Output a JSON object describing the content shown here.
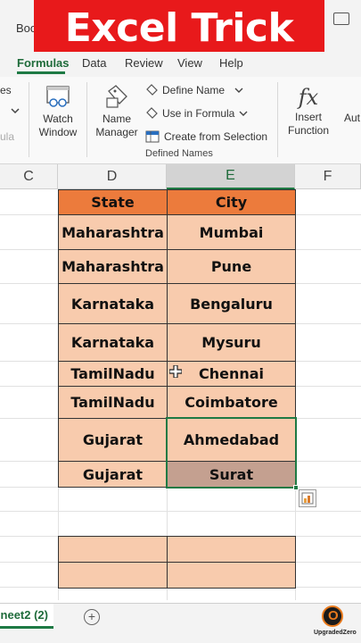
{
  "window": {
    "doc_title": "Boo"
  },
  "banner": {
    "text": "Excel Trick"
  },
  "tabs": [
    "Formulas",
    "Data",
    "Review",
    "View",
    "Help"
  ],
  "ribbon": {
    "left_partial_1": "es",
    "left_partial_2": "ula",
    "watch_window": [
      "Watch",
      "Window"
    ],
    "name_manager": [
      "Name",
      "Manager"
    ],
    "define_name": "Define Name",
    "use_in_formula": "Use in Formula",
    "create_from_selection": "Create from Selection",
    "group_label": "Defined Names",
    "insert_function_icon": "fx",
    "insert_function": [
      "Insert",
      "Function"
    ],
    "auto_partial": "Aut"
  },
  "columns": [
    "C",
    "D",
    "E",
    "F"
  ],
  "table": {
    "headers": {
      "state": "State",
      "city": "City"
    },
    "rows": [
      {
        "state": "Maharashtra",
        "city": "Mumbai"
      },
      {
        "state": "Maharashtra",
        "city": "Pune"
      },
      {
        "state": "Karnataka",
        "city": "Bengaluru"
      },
      {
        "state": "Karnataka",
        "city": "Mysuru"
      },
      {
        "state": "TamilNadu",
        "city": "Chennai"
      },
      {
        "state": "TamilNadu",
        "city": "Coimbatore"
      },
      {
        "state": "Gujarat",
        "city": "Ahmedabad"
      },
      {
        "state": "Gujarat",
        "city": "Surat"
      }
    ]
  },
  "sheet": {
    "tab_label": "neet2 (2)",
    "add_label": "+"
  },
  "watermark": {
    "letter": "O",
    "text": "UpgradedZero"
  },
  "colors": {
    "accent": "#1e7a44",
    "header_fill": "#ec7b3c",
    "body_fill": "#f8cbad",
    "banner": "#e8191b"
  }
}
